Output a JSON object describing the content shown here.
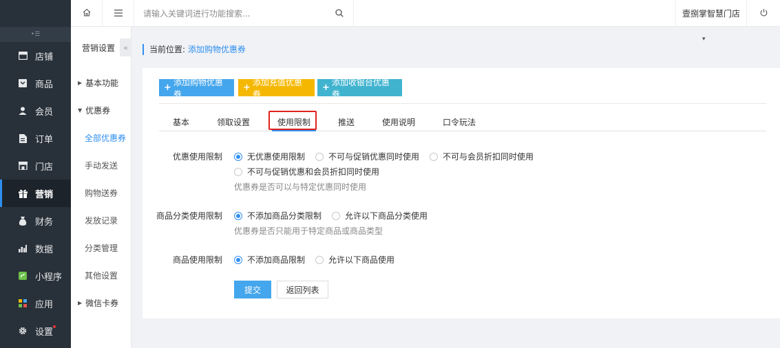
{
  "sidebar": {
    "items": [
      {
        "label": "店铺",
        "icon": "store-icon"
      },
      {
        "label": "商品",
        "icon": "goods-icon"
      },
      {
        "label": "会员",
        "icon": "member-icon"
      },
      {
        "label": "订单",
        "icon": "order-icon"
      },
      {
        "label": "门店",
        "icon": "shop-icon"
      },
      {
        "label": "营销",
        "icon": "gift-icon",
        "active": true
      },
      {
        "label": "财务",
        "icon": "finance-icon"
      },
      {
        "label": "数据",
        "icon": "chart-icon"
      },
      {
        "label": "小程序",
        "icon": "miniapp-icon"
      },
      {
        "label": "应用",
        "icon": "apps-icon"
      },
      {
        "label": "设置",
        "icon": "gear-icon"
      }
    ]
  },
  "topbar": {
    "search_placeholder": "请输入关键词进行功能搜索...",
    "store_name": "壹捌掌智慧门店"
  },
  "submenu": {
    "title": "营销设置",
    "items": {
      "basic": "基本功能",
      "coupons": "优惠券",
      "all_coupons": "全部优惠券",
      "manual_send": "手动发送",
      "shopping_gift": "购物送券",
      "send_records": "发放记录",
      "category_manage": "分类管理",
      "other_settings": "其他设置",
      "wechat_card": "微信卡券"
    }
  },
  "breadcrumb": {
    "label": "当前位置:",
    "current": "添加购物优惠券"
  },
  "actions": {
    "add_shopping": "添加购物优惠券",
    "add_recharge": "添加充值优惠券",
    "add_cashier": "添加收银台优惠券"
  },
  "tabs": [
    "基本",
    "领取设置",
    "使用限制",
    "推送",
    "使用说明",
    "口令玩法"
  ],
  "active_tab": "使用限制",
  "form": {
    "discount": {
      "label": "优惠使用限制",
      "options": [
        "无优惠使用限制",
        "不可与促销优惠同时使用",
        "不可与会员折扣同时使用",
        "不可与促销优惠和会员折扣同时使用"
      ],
      "selected": "无优惠使用限制",
      "hint": "优惠券是否可以与特定优惠同时使用"
    },
    "category": {
      "label": "商品分类使用限制",
      "options": [
        "不添加商品分类限制",
        "允许以下商品分类使用"
      ],
      "selected": "不添加商品分类限制",
      "hint": "优惠券是否只能用于特定商品或商品类型"
    },
    "goods": {
      "label": "商品使用限制",
      "options": [
        "不添加商品限制",
        "允许以下商品使用"
      ],
      "selected": "不添加商品限制"
    },
    "submit": "提交",
    "back": "返回列表"
  },
  "colors": {
    "sidebar_bg": "#283039",
    "primary": "#2f8ff0",
    "btn_blue": "#44a6ec",
    "btn_yellow": "#f5b800",
    "btn_teal": "#40b3cf",
    "highlight_red": "#e0211d"
  }
}
